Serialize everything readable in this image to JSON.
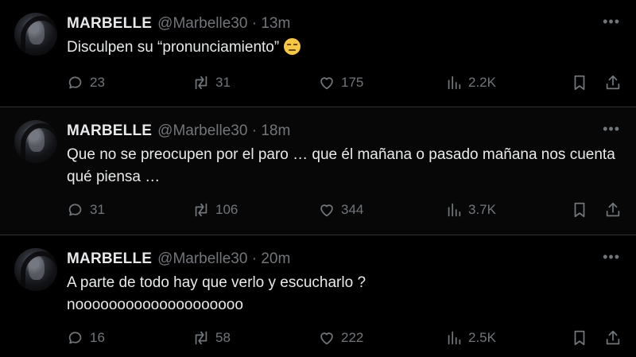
{
  "tweets": [
    {
      "name": "MARBELLE",
      "handle": "@Marbelle30 · 13m",
      "text": "Disculpen su “pronunciamiento”",
      "emoji": "unamused-face",
      "replies": "23",
      "retweets": "31",
      "likes": "175",
      "views": "2.2K"
    },
    {
      "name": "MARBELLE",
      "handle": "@Marbelle30 · 18m",
      "text": "Que no se preocupen por el paro … que él mañana o pasado mañana  nos cuenta qué piensa …",
      "replies": "31",
      "retweets": "106",
      "likes": "344",
      "views": "3.7K"
    },
    {
      "name": "MARBELLE",
      "handle": "@Marbelle30 · 20m",
      "text": "A parte de todo hay que verlo y escucharlo ? noooooooooooooooooooo",
      "replies": "16",
      "retweets": "58",
      "likes": "222",
      "views": "2.5K"
    }
  ],
  "icons": {
    "more": "more-icon",
    "reply": "reply-icon",
    "retweet": "retweet-icon",
    "like": "heart-icon",
    "views": "views-icon",
    "bookmark": "bookmark-icon",
    "share": "share-icon"
  }
}
